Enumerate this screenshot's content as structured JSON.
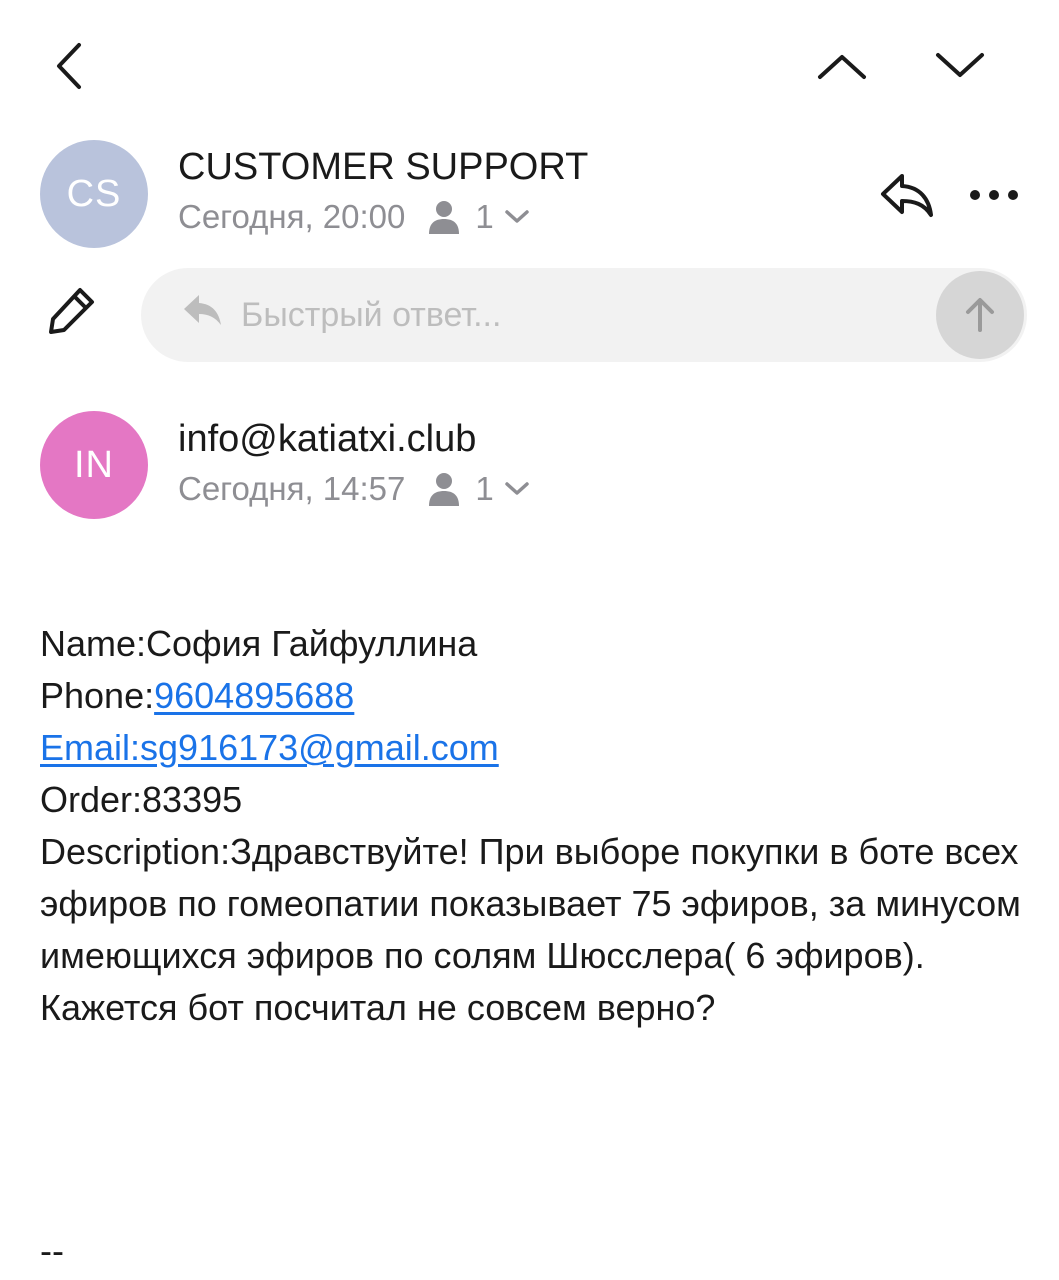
{
  "nav": {
    "back_icon": "chevron-left-icon",
    "prev_icon": "chevron-up-icon",
    "next_icon": "chevron-down-icon"
  },
  "thread": [
    {
      "avatar_initials": "CS",
      "avatar_color": "#b9c3dc",
      "sender": "CUSTOMER SUPPORT",
      "time": "Сегодня, 20:00",
      "recipients_count": "1"
    },
    {
      "avatar_initials": "IN",
      "avatar_color": "#e477c4",
      "sender": "info@katiatxi.club",
      "time": "Сегодня, 14:57",
      "recipients_count": "1"
    }
  ],
  "actions": {
    "reply_icon": "reply-icon",
    "more_icon": "more-icon",
    "compose_icon": "pencil-icon"
  },
  "quick_reply": {
    "placeholder": "Быстрый ответ...",
    "send_icon": "arrow-up-icon"
  },
  "message": {
    "name_label": "Name:",
    "name_value": "София Гайфуллина",
    "phone_label": "Phone:",
    "phone_value": "9604895688",
    "email_line": "Email:sg916173@gmail.com",
    "order_label": "Order:",
    "order_value": "83395",
    "description_label": "Description:",
    "description_value": "Здравствуйте! При выборе покупки в боте всех эфиров по гомеопатии показывает 75 эфиров, за минусом имеющихся эфиров по солям Шюсслера( 6 эфиров). Кажется бот посчитал не совсем верно?",
    "signature": "--"
  },
  "colors": {
    "link": "#1a73e8",
    "secondary_text": "#8e8e93",
    "input_bg": "#f2f2f2"
  }
}
